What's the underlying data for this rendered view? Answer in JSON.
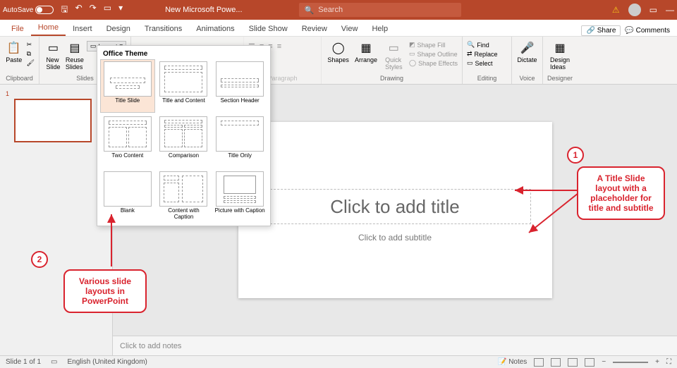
{
  "titlebar": {
    "autosave_label": "AutoSave",
    "autosave_state": "Off",
    "doc_title": "New Microsoft Powe...",
    "search_placeholder": "Search"
  },
  "menu": {
    "tabs": [
      "File",
      "Home",
      "Insert",
      "Design",
      "Transitions",
      "Animations",
      "Slide Show",
      "Review",
      "View",
      "Help"
    ],
    "share": "Share",
    "comments": "Comments"
  },
  "ribbon": {
    "clipboard": {
      "paste": "Paste",
      "label": "Clipboard"
    },
    "slides": {
      "new_slide": "New\nSlide",
      "reuse": "Reuse\nSlides",
      "layout_btn": "Layout",
      "label": "Slides"
    },
    "paragraph": {
      "label": "Paragraph"
    },
    "drawing": {
      "shapes": "Shapes",
      "arrange": "Arrange",
      "quick": "Quick\nStyles",
      "fill": "Shape Fill",
      "outline": "Shape Outline",
      "effects": "Shape Effects",
      "label": "Drawing"
    },
    "editing": {
      "find": "Find",
      "replace": "Replace",
      "select": "Select",
      "label": "Editing"
    },
    "voice": {
      "dictate": "Dictate",
      "label": "Voice"
    },
    "designer": {
      "ideas": "Design\nIdeas",
      "label": "Designer"
    }
  },
  "layout_dropdown": {
    "heading": "Office Theme",
    "items": [
      "Title Slide",
      "Title and Content",
      "Section Header",
      "Two Content",
      "Comparison",
      "Title Only",
      "Blank",
      "Content with Caption",
      "Picture with Caption"
    ]
  },
  "slide": {
    "title_placeholder": "Click to add title",
    "subtitle_placeholder": "Click to add subtitle"
  },
  "notes": {
    "placeholder": "Click to add notes"
  },
  "status": {
    "slide_info": "Slide 1 of 1",
    "language": "English (United Kingdom)",
    "notes_btn": "Notes"
  },
  "annotations": {
    "callout1_num": "1",
    "callout1_text": "A Title Slide layout with a placeholder for title and subtitle",
    "callout2_num": "2",
    "callout2_text": "Various slide layouts in PowerPoint"
  },
  "thumbnail": {
    "number": "1"
  }
}
